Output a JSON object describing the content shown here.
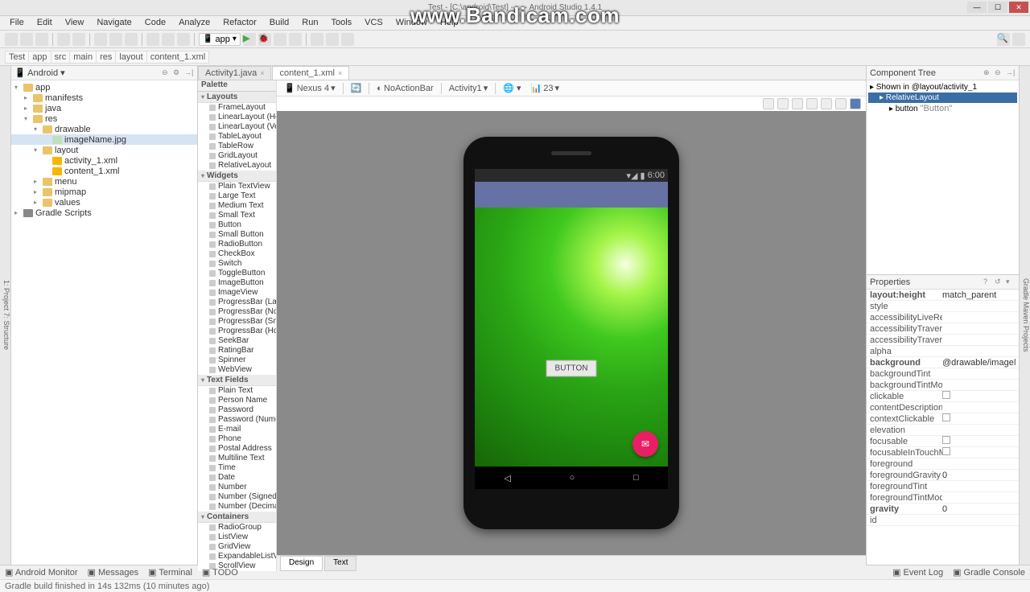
{
  "window": {
    "title": "Test - [C:\\android\\Test] - ... - Android Studio 1.4.1"
  },
  "watermark": "www.Bandicam.com",
  "menu": [
    "File",
    "Edit",
    "View",
    "Navigate",
    "Code",
    "Analyze",
    "Refactor",
    "Build",
    "Run",
    "Tools",
    "VCS",
    "Window",
    "Help"
  ],
  "toolbar": {
    "run_config": "app"
  },
  "breadcrumb": [
    "Test",
    "app",
    "src",
    "main",
    "res",
    "layout",
    "content_1.xml"
  ],
  "project_tree": {
    "label": "Android",
    "nodes": [
      {
        "d": 0,
        "t": "▾",
        "i": "folder",
        "l": "app"
      },
      {
        "d": 1,
        "t": "▸",
        "i": "folder",
        "l": "manifests"
      },
      {
        "d": 1,
        "t": "▸",
        "i": "folder",
        "l": "java"
      },
      {
        "d": 1,
        "t": "▾",
        "i": "folder",
        "l": "res"
      },
      {
        "d": 2,
        "t": "▾",
        "i": "folder",
        "l": "drawable"
      },
      {
        "d": 3,
        "t": "",
        "i": "file",
        "l": "imageName.jpg",
        "sel": true
      },
      {
        "d": 2,
        "t": "▾",
        "i": "folder",
        "l": "layout"
      },
      {
        "d": 3,
        "t": "",
        "i": "xml",
        "l": "activity_1.xml"
      },
      {
        "d": 3,
        "t": "",
        "i": "xml",
        "l": "content_1.xml"
      },
      {
        "d": 2,
        "t": "▸",
        "i": "folder",
        "l": "menu"
      },
      {
        "d": 2,
        "t": "▸",
        "i": "folder",
        "l": "mipmap"
      },
      {
        "d": 2,
        "t": "▸",
        "i": "folder",
        "l": "values"
      },
      {
        "d": 0,
        "t": "▸",
        "i": "pkg",
        "l": "Gradle Scripts"
      }
    ]
  },
  "editor_tabs": [
    {
      "label": "Activity1.java",
      "active": false
    },
    {
      "label": "content_1.xml",
      "active": true
    }
  ],
  "palette": {
    "title": "Palette",
    "sections": [
      {
        "name": "Layouts",
        "items": [
          "FrameLayout",
          "LinearLayout (Horizontal)",
          "LinearLayout (Vertical)",
          "TableLayout",
          "TableRow",
          "GridLayout",
          "RelativeLayout"
        ]
      },
      {
        "name": "Widgets",
        "items": [
          "Plain TextView",
          "Large Text",
          "Medium Text",
          "Small Text",
          "Button",
          "Small Button",
          "RadioButton",
          "CheckBox",
          "Switch",
          "ToggleButton",
          "ImageButton",
          "ImageView",
          "ProgressBar (Large)",
          "ProgressBar (Normal)",
          "ProgressBar (Small)",
          "ProgressBar (Horizontal)",
          "SeekBar",
          "RatingBar",
          "Spinner",
          "WebView"
        ]
      },
      {
        "name": "Text Fields",
        "items": [
          "Plain Text",
          "Person Name",
          "Password",
          "Password (Numeric)",
          "E-mail",
          "Phone",
          "Postal Address",
          "Multiline Text",
          "Time",
          "Date",
          "Number",
          "Number (Signed)",
          "Number (Decimal)"
        ]
      },
      {
        "name": "Containers",
        "items": [
          "RadioGroup",
          "ListView",
          "GridView",
          "ExpandableListView",
          "ScrollView"
        ]
      }
    ]
  },
  "design_toolbar": {
    "device": "Nexus 4",
    "theme": "NoActionBar",
    "context": "Activity1",
    "api": "23"
  },
  "preview": {
    "status_time": "6:00",
    "button_label": "BUTTON"
  },
  "design_tabs": {
    "design": "Design",
    "text": "Text"
  },
  "component_tree": {
    "title": "Component Tree",
    "nodes": [
      {
        "d": 0,
        "l": "Shown in @layout/activity_1",
        "sub": "",
        "sel": false
      },
      {
        "d": 1,
        "l": "RelativeLayout",
        "sub": "",
        "sel": true
      },
      {
        "d": 2,
        "l": "button",
        "sub": "\"Button\"",
        "sel": false
      }
    ]
  },
  "properties": {
    "title": "Properties",
    "rows": [
      {
        "k": "layout:height",
        "v": "match_parent",
        "b": true
      },
      {
        "k": "style",
        "v": ""
      },
      {
        "k": "accessibilityLiveRegion",
        "v": ""
      },
      {
        "k": "accessibilityTraversalAfter",
        "v": ""
      },
      {
        "k": "accessibilityTraversalBefore",
        "v": ""
      },
      {
        "k": "alpha",
        "v": ""
      },
      {
        "k": "background",
        "v": "@drawable/imageName",
        "b": true
      },
      {
        "k": "backgroundTint",
        "v": ""
      },
      {
        "k": "backgroundTintMode",
        "v": ""
      },
      {
        "k": "clickable",
        "v": "",
        "chk": true
      },
      {
        "k": "contentDescription",
        "v": ""
      },
      {
        "k": "contextClickable",
        "v": "",
        "chk": true
      },
      {
        "k": "elevation",
        "v": ""
      },
      {
        "k": "focusable",
        "v": "",
        "chk": true
      },
      {
        "k": "focusableInTouchMode",
        "v": "",
        "chk": true
      },
      {
        "k": "foreground",
        "v": ""
      },
      {
        "k": "foregroundGravity",
        "v": "0"
      },
      {
        "k": "foregroundTint",
        "v": ""
      },
      {
        "k": "foregroundTintMode",
        "v": ""
      },
      {
        "k": "gravity",
        "v": "0",
        "b": true
      },
      {
        "k": "id",
        "v": ""
      }
    ]
  },
  "footer_tabs": {
    "left": [
      "Android Monitor",
      "Messages",
      "Terminal",
      "TODO"
    ],
    "right": [
      "Event Log",
      "Gradle Console"
    ]
  },
  "status_text": "Gradle build finished in 14s 132ms (10 minutes ago)"
}
